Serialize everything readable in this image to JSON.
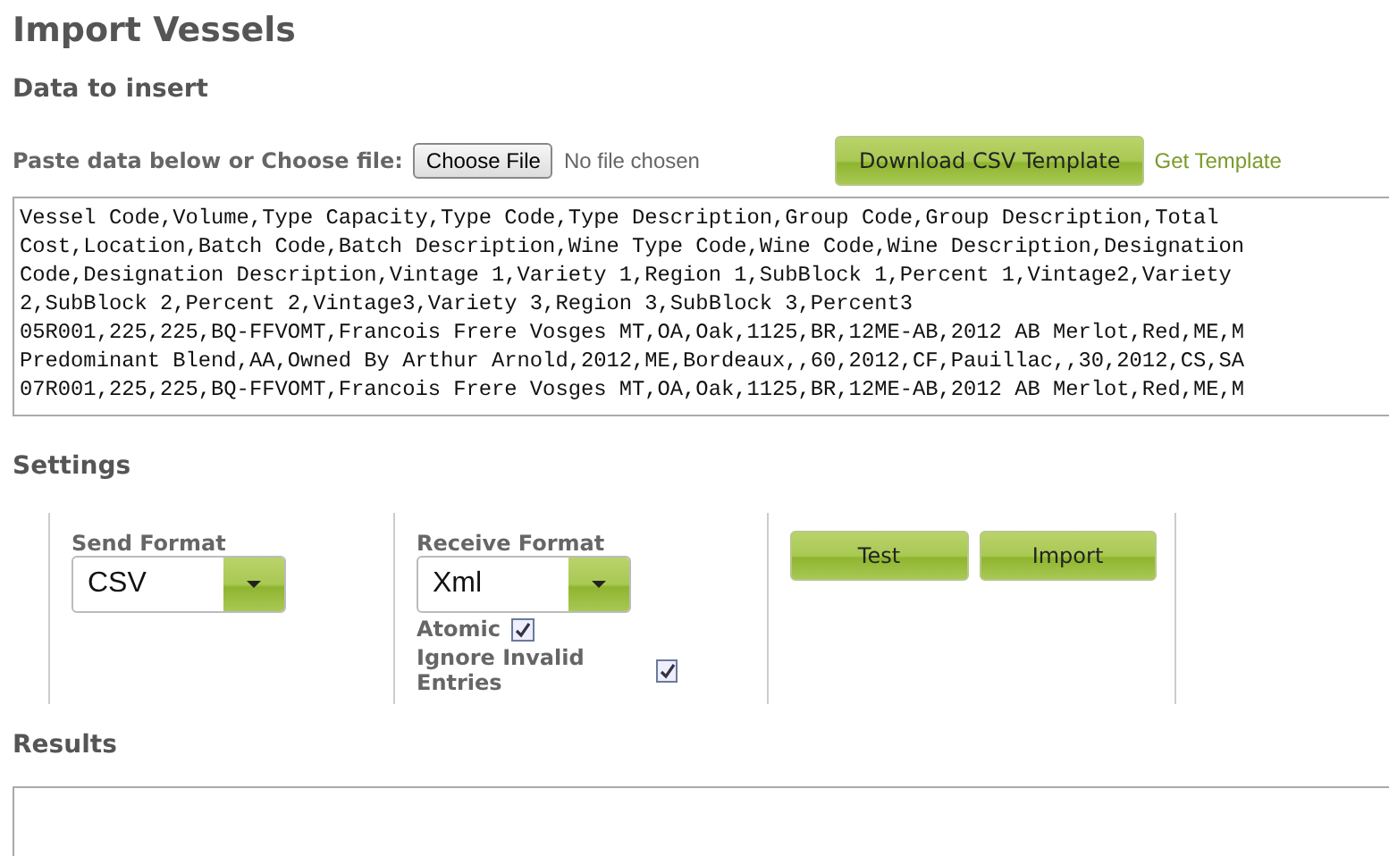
{
  "page_title": "Import Vessels",
  "data_section": {
    "heading": "Data to insert",
    "paste_label": "Paste data below or Choose file:",
    "file_button": "Choose File",
    "file_status": "No file chosen",
    "download_button": "Download CSV Template",
    "template_link": "Get Template",
    "csv_lines": [
      "Vessel Code,Volume,Type Capacity,Type Code,Type Description,Group Code,Group Description,Total",
      "Cost,Location,Batch Code,Batch Description,Wine Type Code,Wine Code,Wine Description,Designation",
      "Code,Designation Description,Vintage 1,Variety 1,Region 1,SubBlock 1,Percent 1,Vintage2,Variety",
      "2,SubBlock 2,Percent 2,Vintage3,Variety 3,Region 3,SubBlock 3,Percent3",
      "05R001,225,225,BQ-FFVOMT,Francois Frere Vosges MT,OA,Oak,1125,BR,12ME-AB,2012 AB Merlot,Red,ME,M",
      "Predominant Blend,AA,Owned By Arthur Arnold,2012,ME,Bordeaux,,60,2012,CF,Pauillac,,30,2012,CS,SA",
      "07R001,225,225,BQ-FFVOMT,Francois Frere Vosges MT,OA,Oak,1125,BR,12ME-AB,2012 AB Merlot,Red,ME,M"
    ]
  },
  "settings": {
    "heading": "Settings",
    "send_format": {
      "label": "Send Format",
      "value": "CSV"
    },
    "receive_format": {
      "label": "Receive Format",
      "value": "Xml"
    },
    "options": [
      {
        "label": "Atomic",
        "checked": true
      },
      {
        "label": "Ignore Invalid Entries",
        "checked": true
      }
    ],
    "buttons": [
      "Test",
      "Import"
    ]
  },
  "results": {
    "heading": "Results"
  }
}
